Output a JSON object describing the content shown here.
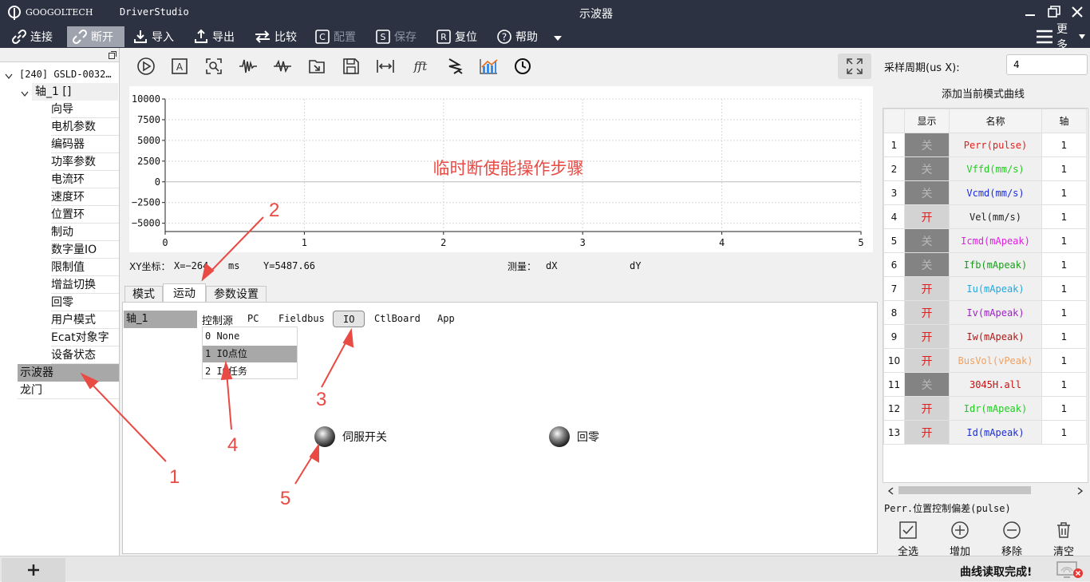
{
  "app": {
    "logo_text": "GOOGOLTECH",
    "name": "DriverStudio",
    "window_title": "示波器"
  },
  "toolbar": {
    "connect": "连接",
    "disconnect": "断开",
    "import": "导入",
    "export": "导出",
    "compare": "比较",
    "config": "配置",
    "save": "保存",
    "reset": "复位",
    "help": "帮助",
    "more": "更多"
  },
  "tree": {
    "device": "[240] GSLD-0032…",
    "axis": "轴_1 []",
    "items": [
      "向导",
      "电机参数",
      "编码器",
      "功率参数",
      "电流环",
      "速度环",
      "位置环",
      "制动",
      "数字量IO",
      "限制值",
      "增益切换",
      "回零",
      "用户模式",
      "Ecat对象字",
      "设备状态"
    ],
    "scope": "示波器",
    "gantry": "龙门"
  },
  "chart_data": {
    "type": "line",
    "title": "临时断使能操作步骤",
    "xlim": [
      0,
      5
    ],
    "ylim": [
      -6000,
      10000
    ],
    "x_ticks": [
      "0",
      "1",
      "2",
      "3",
      "4",
      "5"
    ],
    "y_ticks": [
      "10000",
      "7500",
      "5000",
      "2500",
      "0",
      "−2500",
      "−5000"
    ],
    "series": [],
    "grid": true
  },
  "readout": {
    "xy_label": "XY坐标：",
    "x": "X=−264",
    "x_unit": "ms",
    "y": "Y=5487.66",
    "measure": "测量：",
    "dx": "dX",
    "dy": "dY"
  },
  "tabs": [
    "模式",
    "运动",
    "参数设置"
  ],
  "motion": {
    "axis_label": "轴_1",
    "source_label": "控制源",
    "sources": [
      "PC",
      "Fieldbus",
      "IO",
      "CtlBoard",
      "App"
    ],
    "selected_source": "IO",
    "io_options": [
      "0 None",
      "1 IO点位",
      "2 IO任务"
    ],
    "servo_switch": "伺服开关",
    "homing": "回零"
  },
  "annotations": [
    "1",
    "2",
    "3",
    "4",
    "5"
  ],
  "right": {
    "period_label": "采样周期(us X):",
    "period_value": "4",
    "add_title": "添加当前模式曲线",
    "headers": [
      "显示",
      "名称",
      "轴"
    ],
    "rows": [
      {
        "idx": "1",
        "show": "关",
        "name": "Perr(pulse)",
        "color": "#e02020",
        "axis": "1"
      },
      {
        "idx": "2",
        "show": "关",
        "name": "Vffd(mm/s)",
        "color": "#22cc22",
        "axis": "1"
      },
      {
        "idx": "3",
        "show": "关",
        "name": "Vcmd(mm/s)",
        "color": "#1c2cd8",
        "axis": "1"
      },
      {
        "idx": "4",
        "show": "开",
        "name": "Vel(mm/s)",
        "color": "#222222",
        "axis": "1"
      },
      {
        "idx": "5",
        "show": "关",
        "name": "Icmd(mApeak)",
        "color": "#e020e0",
        "axis": "1"
      },
      {
        "idx": "6",
        "show": "关",
        "name": "Ifb(mApeak)",
        "color": "#1c9c1c",
        "axis": "1"
      },
      {
        "idx": "7",
        "show": "开",
        "name": "Iu(mApeak)",
        "color": "#20a8e0",
        "axis": "1"
      },
      {
        "idx": "8",
        "show": "开",
        "name": "Iv(mApeak)",
        "color": "#a020c8",
        "axis": "1"
      },
      {
        "idx": "9",
        "show": "开",
        "name": "Iw(mApeak)",
        "color": "#b01818",
        "axis": "1"
      },
      {
        "idx": "10",
        "show": "开",
        "name": "BusVol(vPeak)",
        "color": "#f0a060",
        "axis": "1"
      },
      {
        "idx": "11",
        "show": "关",
        "name": "3045H.all",
        "color": "#c81010",
        "axis": "1"
      },
      {
        "idx": "12",
        "show": "开",
        "name": "Idr(mApeak)",
        "color": "#22cc22",
        "axis": "1"
      },
      {
        "idx": "13",
        "show": "开",
        "name": "Id(mApeak)",
        "color": "#1c2cd8",
        "axis": "1"
      }
    ],
    "desc": "Perr.位置控制偏差(pulse)",
    "buttons": [
      "全选",
      "增加",
      "移除",
      "清空"
    ]
  },
  "status": {
    "message": "曲线读取完成!"
  },
  "colors": {
    "titlebar": "#2c3242",
    "annotation": "#e94a44",
    "on": "#e02020"
  }
}
